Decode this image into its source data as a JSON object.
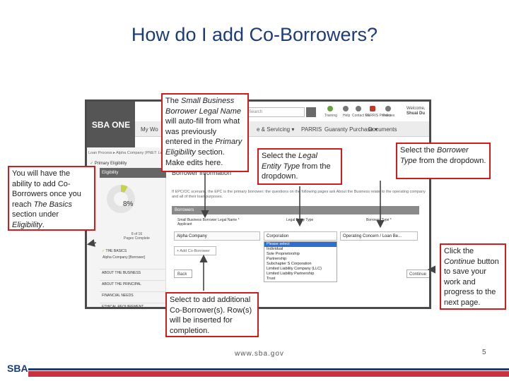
{
  "slide": {
    "title": "How do I add Co-Borrowers?",
    "footer_url": "www.sba.gov",
    "page_number": "5",
    "sba_mark": "SBA"
  },
  "screenshot": {
    "logo": "SBA ONE",
    "nav": [
      "My Wo",
      "e & Servicing ▾",
      "PARRIS",
      "Guaranty Purchase ▾",
      "Documents"
    ],
    "search_placeholder": "Search",
    "top_icons": [
      "Training",
      "Help",
      "Contact Us",
      "PARRIS Proxies",
      "Policies"
    ],
    "welcome": [
      "Welcome,",
      "Shuai Du"
    ],
    "breadcrumb": "Loan Process ▸ Alpha Company (PNET: Lenders) ▸",
    "prior_eligibility": "Primary Eligibility",
    "eligibility_label": "Eligibility",
    "progress_percent": "8%",
    "progress_value": 0.08,
    "steps_text": [
      "8 of 16",
      "Pages Complete"
    ],
    "sidebar_items": [
      {
        "label": "THE BASICS"
      },
      {
        "label": "ABOUT THE BUSINESS"
      },
      {
        "label": "ABOUT THE PRINCIPAL"
      },
      {
        "label": "FINANCIAL NEEDS"
      },
      {
        "label": "ETHICAL REQUIREMENT"
      }
    ],
    "sidebar_sub": "Alpha Company [Borrower]",
    "main_title": "Borrower Information",
    "main_desc": "If EPC/OC scenario, the EPC is the primary borrower; the questions on the following pages ask About the Business relate to the operating company and all of their loan purposes.",
    "borrowers_header": "Borrowers",
    "columns": [
      "Small Business Borrower Legal Name *",
      "Legal Entity Type",
      "Borrower Type *"
    ],
    "column_sub": "Applicant",
    "row": {
      "name": "Alpha Company",
      "entity_type": "Corporation",
      "borrower_type": "Operating Concern / Loan Be..."
    },
    "add_button": "+ Add Co-Borrower",
    "back_button": "Back",
    "continue_button": "Continue",
    "dropdown_options": [
      "Please select",
      "Individual",
      "Sole Proprietorship",
      "Partnership",
      "Subchapter S Corporation",
      "Limited Liability Company (LLC)",
      "Limited Liability Partnership",
      "Trust"
    ]
  },
  "callouts": {
    "left": [
      "You will have the ability to add Co-Borrowers once you reach ",
      "The Basics",
      " section under ",
      "Eligibility",
      "."
    ],
    "name": [
      "The ",
      "Small Business Borrower Legal Name",
      " will auto-fill from what was previously entered in the ",
      "Primary Eligibility",
      " section. Make edits here."
    ],
    "entity": [
      "Select the ",
      "Legal Entity Type",
      " from the dropdown."
    ],
    "borrower": [
      "Select the ",
      "Borrower Type",
      " from the dropdown."
    ],
    "continue": [
      "Click the ",
      "Continue",
      " button to save your work and progress to the next page."
    ],
    "add": [
      "Select to add additional Co-Borrower(s). Row(s) will be inserted for completion."
    ]
  },
  "colors": {
    "title": "#1c3c78",
    "callout_border": "#d01c1c",
    "progress_fill": "#c6d34a",
    "footer_bar": "#c8323c"
  }
}
